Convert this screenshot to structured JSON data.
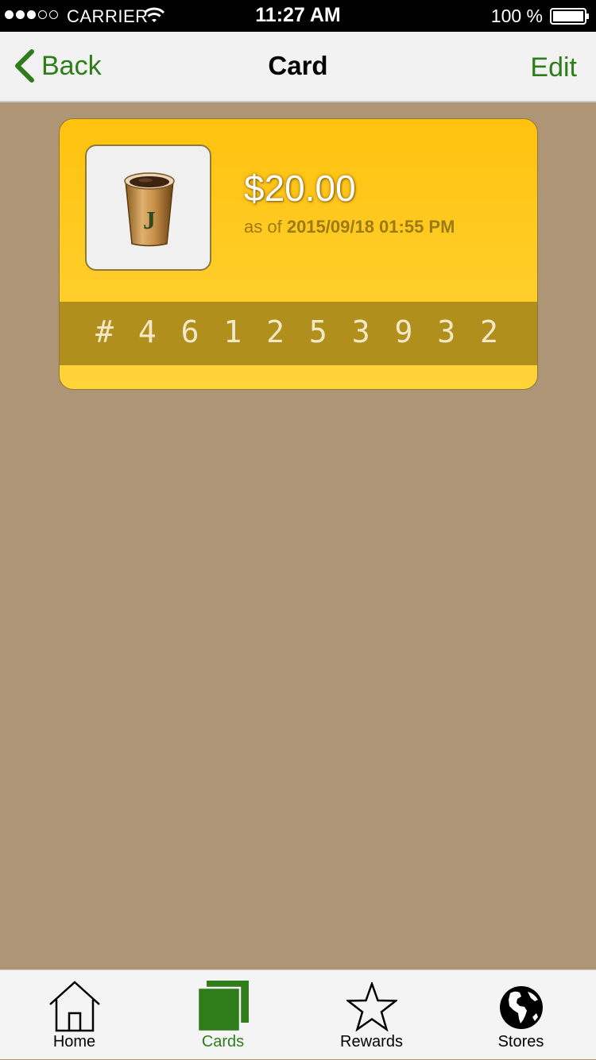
{
  "status_bar": {
    "carrier": "CARRIER",
    "time": "11:27 AM",
    "battery": "100 %"
  },
  "nav": {
    "back_label": "Back",
    "title": "Card",
    "edit_label": "Edit"
  },
  "card": {
    "balance": "$20.00",
    "as_of_prefix": "as of",
    "as_of_date": "2015/09/18 01:55 PM",
    "number": "# 4 6 1 2 5 3 9 3 2",
    "logo_icon": "coffee-cup-icon",
    "logo_letter": "J"
  },
  "tabs": [
    {
      "label": "Home",
      "icon": "home-icon"
    },
    {
      "label": "Cards",
      "icon": "cards-icon"
    },
    {
      "label": "Rewards",
      "icon": "star-icon"
    },
    {
      "label": "Stores",
      "icon": "globe-icon"
    }
  ],
  "colors": {
    "accent": "#2e7d1a",
    "background": "#ad9576",
    "card": "#ffc20e",
    "card_stripe": "#b08f1d"
  }
}
